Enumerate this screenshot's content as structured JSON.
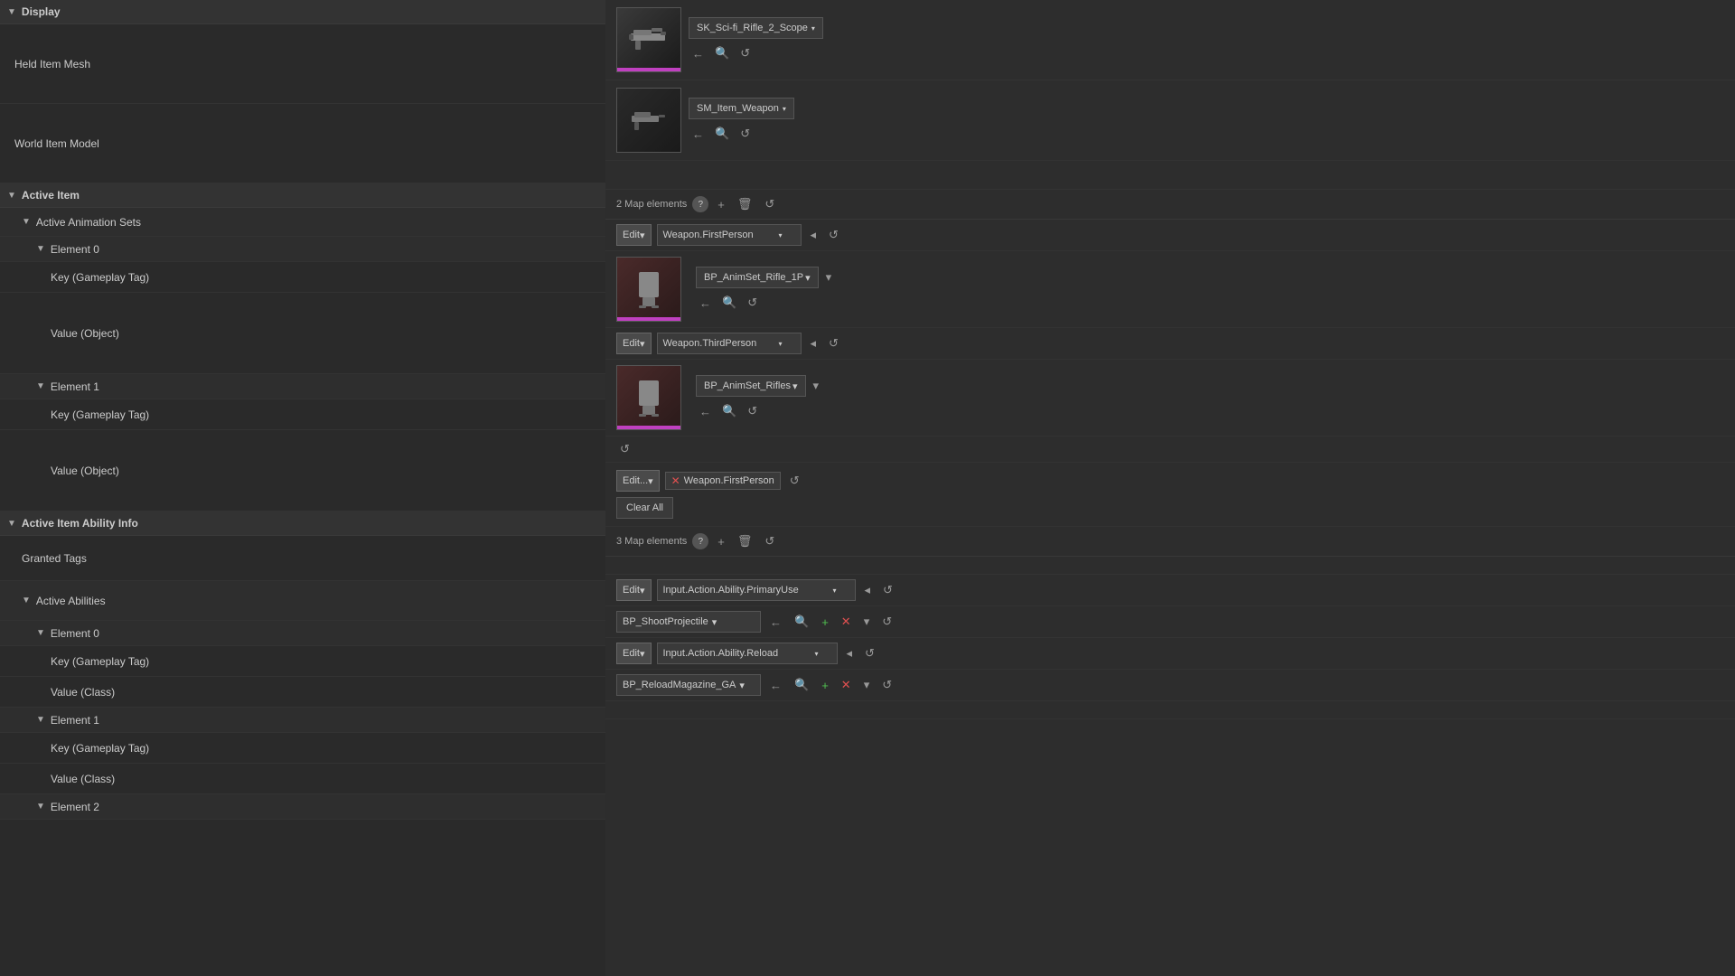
{
  "sections": {
    "display": {
      "label": "Display",
      "heldItemMesh": {
        "label": "Held Item Mesh",
        "asset": "SK_Sci-fi_Rifle_2_Scope"
      },
      "worldItemModel": {
        "label": "World Item Model",
        "asset": "SM_Item_Weapon"
      }
    },
    "activeItem": {
      "label": "Active Item",
      "activeAnimationSets": {
        "label": "Active Animation Sets",
        "mapCount": "2 Map elements",
        "elements": [
          {
            "label": "Element 0",
            "keyLabel": "Key (Gameplay Tag)",
            "keyValue": "Weapon.FirstPerson",
            "valueLabel": "Value (Object)",
            "valueAsset": "BP_AnimSet_Rifle_1P"
          },
          {
            "label": "Element 1",
            "keyLabel": "Key (Gameplay Tag)",
            "keyValue": "Weapon.ThirdPerson",
            "valueLabel": "Value (Object)",
            "valueAsset": "BP_AnimSet_Rifles"
          }
        ]
      }
    },
    "activeItemAbilityInfo": {
      "label": "Active Item Ability Info",
      "grantedTags": {
        "label": "Granted Tags",
        "editLabel": "Edit...",
        "tagValue": "Weapon.FirstPerson",
        "clearAllLabel": "Clear All"
      },
      "activeAbilities": {
        "label": "Active Abilities",
        "mapCount": "3 Map elements",
        "elements": [
          {
            "label": "Element 0",
            "keyLabel": "Key (Gameplay Tag)",
            "keyValue": "Input.Action.Ability.PrimaryUse",
            "valueLabel": "Value (Class)",
            "valueAsset": "BP_ShootProjectile"
          },
          {
            "label": "Element 1",
            "keyLabel": "Key (Gameplay Tag)",
            "keyValue": "Input.Action.Ability.Reload",
            "valueLabel": "Value (Class)",
            "valueAsset": "BP_ReloadMagazine_GA"
          },
          {
            "label": "Element 2",
            "keyLabel": ""
          }
        ]
      }
    }
  },
  "icons": {
    "arrowLeft": "←",
    "search": "🔍",
    "undo": "↺",
    "trash": "🗑",
    "question": "?",
    "plus": "+",
    "chevronDown": "▾",
    "chevronRight": "▸",
    "chevronLeft": "◂",
    "remove": "✕",
    "down": "▼",
    "right": "▶",
    "upDown": "⇕"
  }
}
